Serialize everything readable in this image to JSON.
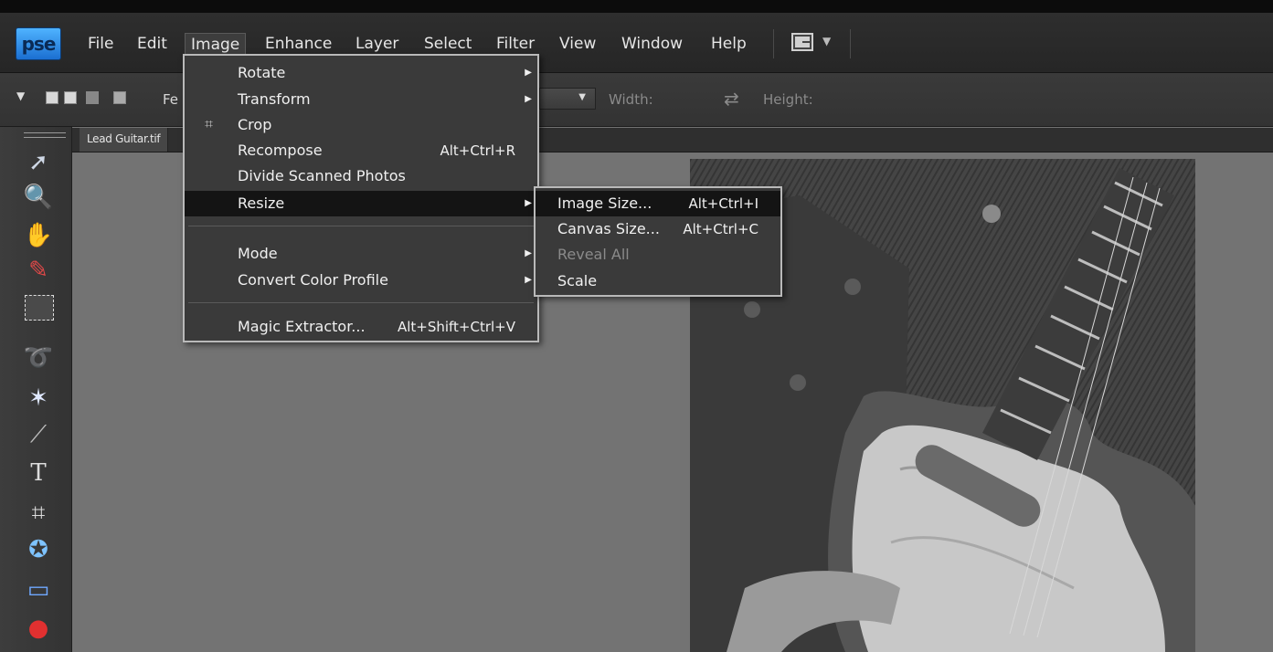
{
  "app": {
    "logo_text": "pse"
  },
  "menubar": {
    "items": [
      "File",
      "Edit",
      "Image",
      "Enhance",
      "Layer",
      "Select",
      "Filter",
      "View",
      "Window",
      "Help"
    ]
  },
  "options_bar": {
    "feather_label": "Fe",
    "width_label": "Width:",
    "height_label": "Height:"
  },
  "document": {
    "tab_title": "Lead Guitar.tif"
  },
  "image_menu": {
    "items": [
      {
        "label": "Rotate",
        "shortcut": "",
        "submenu": true
      },
      {
        "label": "Transform",
        "shortcut": "",
        "submenu": true
      },
      {
        "label": "Crop",
        "shortcut": "",
        "submenu": false,
        "icon": "crop-icon"
      },
      {
        "label": "Recompose",
        "shortcut": "Alt+Ctrl+R",
        "submenu": false
      },
      {
        "label": "Divide Scanned Photos",
        "shortcut": "",
        "submenu": false
      },
      {
        "label": "Resize",
        "shortcut": "",
        "submenu": true,
        "highlighted": true
      },
      {
        "label": "Mode",
        "shortcut": "",
        "submenu": true
      },
      {
        "label": "Convert Color Profile",
        "shortcut": "",
        "submenu": true
      },
      {
        "label": "Magic Extractor...",
        "shortcut": "Alt+Shift+Ctrl+V",
        "submenu": false
      }
    ]
  },
  "resize_submenu": {
    "items": [
      {
        "label": "Image Size...",
        "shortcut": "Alt+Ctrl+I",
        "highlighted": true
      },
      {
        "label": "Canvas Size...",
        "shortcut": "Alt+Ctrl+C"
      },
      {
        "label": "Reveal All",
        "shortcut": "",
        "disabled": true
      },
      {
        "label": "Scale",
        "shortcut": ""
      }
    ]
  },
  "toolbox": {
    "tools": [
      "move-tool-icon",
      "zoom-tool-icon",
      "hand-tool-icon",
      "eyedropper-tool-icon",
      "marquee-tool-icon",
      "lasso-tool-icon",
      "magic-wand-tool-icon",
      "quick-selection-tool-icon",
      "type-tool-icon",
      "crop-tool-icon",
      "cookie-cutter-tool-icon",
      "straighten-tool-icon",
      "red-eye-tool-icon"
    ]
  },
  "colors": {
    "highlight": "#141414",
    "menu_bg": "#3a3a3a",
    "logo_blue": "#3a9be8"
  }
}
